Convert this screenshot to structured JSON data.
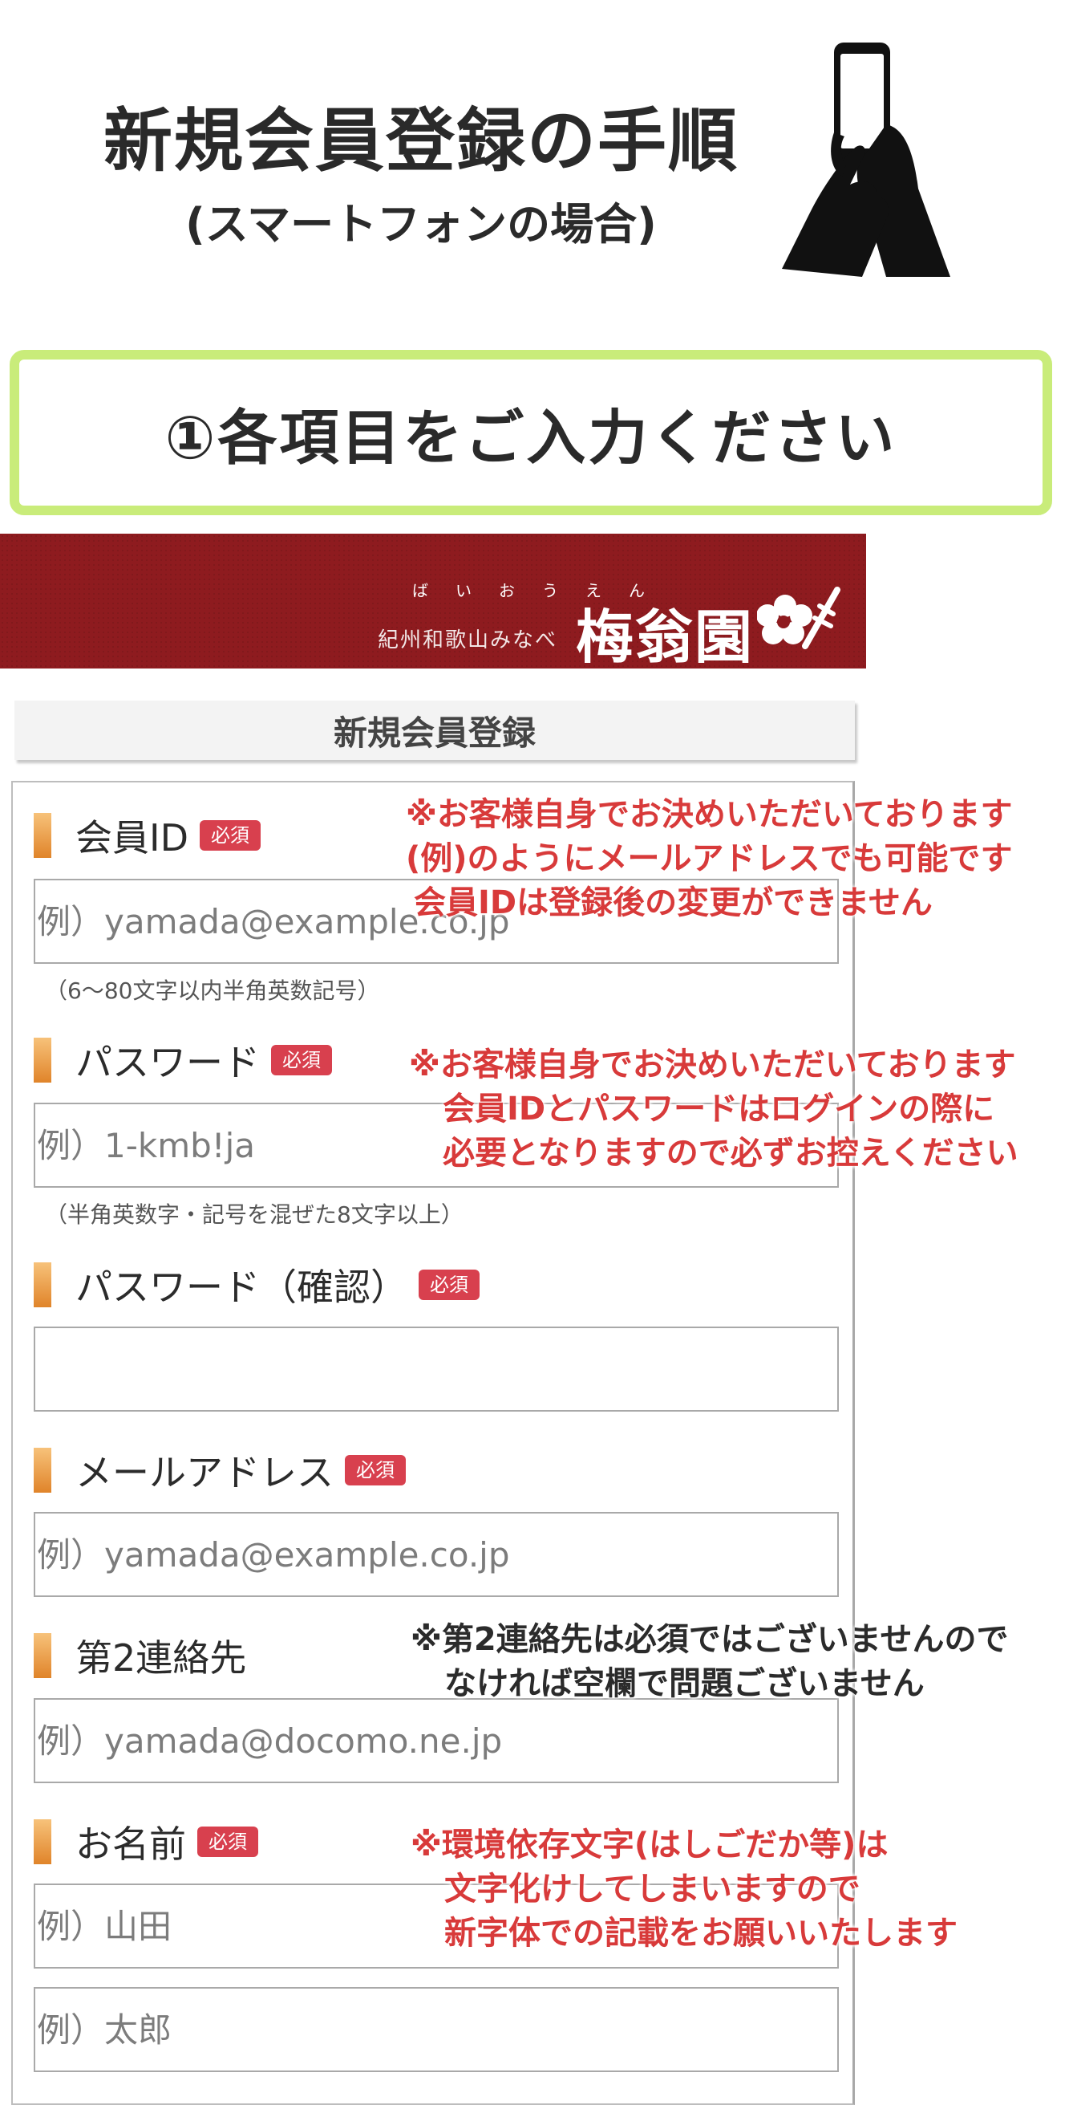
{
  "guide": {
    "title": "新規会員登録の手順",
    "subtitle": "(スマートフォンの場合)",
    "step_banner": "①各項目をご入力ください"
  },
  "shop": {
    "tagline": "紀州和歌山みなべ",
    "ruby": "ばいおうえん",
    "name": "梅翁園"
  },
  "form": {
    "page_title": "新規会員登録",
    "required_badge": "必須",
    "fields": [
      {
        "label": "会員ID",
        "placeholder": "例）yamada@example.co.jp",
        "hint": "（6～80文字以内半角英数記号）"
      },
      {
        "label": "パスワード",
        "placeholder": "例）1-kmb!ja",
        "hint": "（半角英数字・記号を混ぜた8文字以上）"
      },
      {
        "label": "パスワード（確認）",
        "placeholder": ""
      },
      {
        "label": "メールアドレス",
        "placeholder": "例）yamada@example.co.jp"
      },
      {
        "label": "第2連絡先",
        "placeholder": "例）yamada@docomo.ne.jp"
      },
      {
        "label": "お名前",
        "placeholder_last": "例）山田",
        "placeholder_first": "例）太郎"
      }
    ]
  },
  "notes": {
    "member_id": [
      "※お客様自身でお決めいただいております",
      "(例)のようにメールアドレスでも可能です",
      "会員IDは登録後の変更ができません"
    ],
    "password": [
      "※お客様自身でお決めいただいております",
      "会員IDとパスワードはログインの際に",
      "必要となりますので必ずお控えください"
    ],
    "second_contact": [
      "※第2連絡先は必須ではございませんので",
      "なければ空欄で問題ございません"
    ],
    "name": [
      "※環境依存文字(はしごだか等)は",
      "文字化けしてしまいますので",
      "新字体での記載をお願いいたします"
    ]
  },
  "colors": {
    "banner_border": "#c9ec7a",
    "shop_header_bg": "#8e1b1f",
    "badge_bg": "#d8404e",
    "note_red": "#d83a3a",
    "label_bar": "#e0842a"
  },
  "icons": {
    "phone_illustration": "hand-holding-smartphone-icon",
    "shop_logo": "plum-blossom-logo-icon"
  }
}
